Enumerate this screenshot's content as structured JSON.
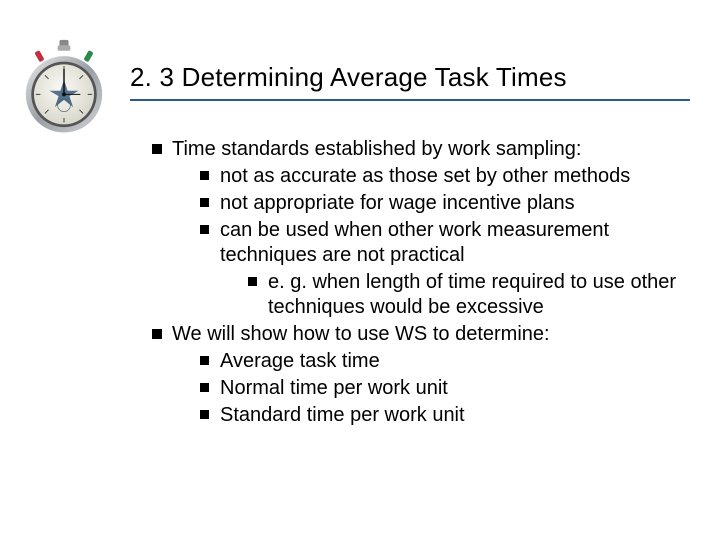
{
  "icon_name": "stopwatch-icon",
  "title": "2. 3 Determining Average Task Times",
  "bullets": {
    "top": [
      {
        "text": "Time standards established by work sampling:",
        "children": [
          {
            "text": "not as accurate as those set by other methods"
          },
          {
            "text": "not appropriate for wage incentive plans"
          },
          {
            "text": "can be used when other work measurement techniques are not practical",
            "children": [
              {
                "text": "e. g. when length of time required to use other techniques would be excessive"
              }
            ]
          }
        ]
      },
      {
        "text": "We will show how to use WS to determine:",
        "children": [
          {
            "text": "Average task time"
          },
          {
            "text": "Normal time per work unit"
          },
          {
            "text": "Standard time per work unit"
          }
        ]
      }
    ]
  }
}
